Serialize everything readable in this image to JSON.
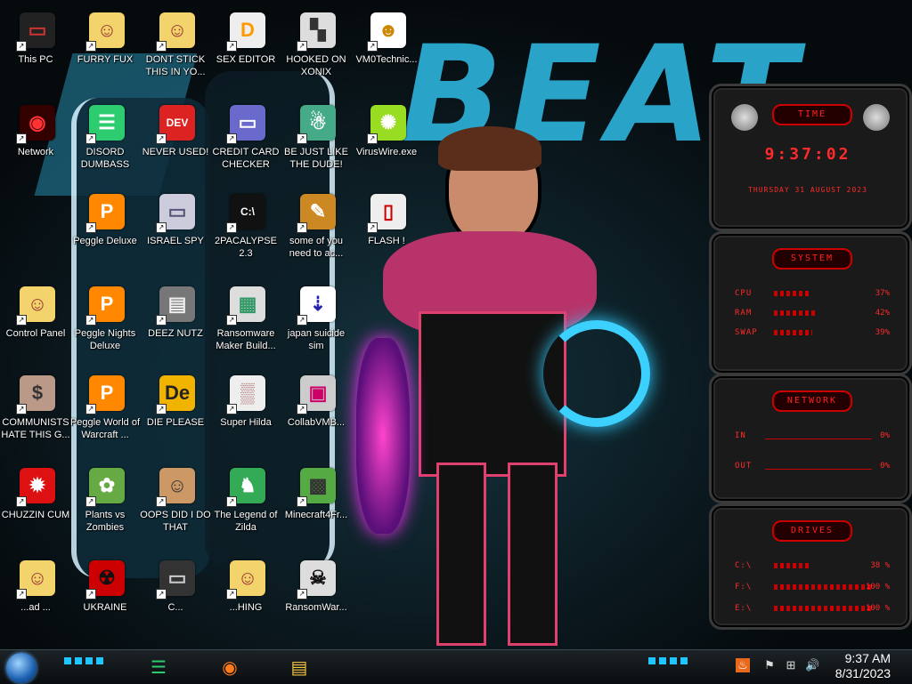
{
  "desktop": {
    "icons": [
      {
        "label": "This PC",
        "glyph": "▭",
        "bg": "#222",
        "fg": "#c33"
      },
      {
        "label": "FURRY FUX",
        "glyph": "☺",
        "bg": "#f3d36b",
        "fg": "#933"
      },
      {
        "label": "DONT STICK THIS IN YO...",
        "glyph": "☺",
        "bg": "#f3d36b",
        "fg": "#933"
      },
      {
        "label": "SEX EDITOR",
        "glyph": "D",
        "bg": "#eee",
        "fg": "#f90"
      },
      {
        "label": "HOOKED ON XONIX",
        "glyph": "▚",
        "bg": "#ddd",
        "fg": "#333"
      },
      {
        "label": "VM0Technic...",
        "glyph": "☻",
        "bg": "#fff",
        "fg": "#c80"
      },
      {
        "label": "Network",
        "glyph": "◉",
        "bg": "#300",
        "fg": "#f33"
      },
      {
        "label": "DISORD DUMBASS",
        "glyph": "☰",
        "bg": "#2ecc71",
        "fg": "#fff"
      },
      {
        "label": "NEVER USED!",
        "glyph": "DEV",
        "bg": "#d22",
        "fg": "#fff"
      },
      {
        "label": "CREDIT CARD CHECKER",
        "glyph": "▭",
        "bg": "#6a6acc",
        "fg": "#fff"
      },
      {
        "label": "BE JUST LIKE THE DUDE!",
        "glyph": "☃",
        "bg": "#4a8",
        "fg": "#fff"
      },
      {
        "label": "VirusWire.exe",
        "glyph": "✺",
        "bg": "#9d2",
        "fg": "#fff"
      },
      {
        "label": "Peggle Deluxe",
        "glyph": "P",
        "bg": "#f80",
        "fg": "#fff"
      },
      {
        "label": "ISRAEL SPY",
        "glyph": "▭",
        "bg": "#ccd",
        "fg": "#557"
      },
      {
        "label": "2PACALYPSE 2.3",
        "glyph": "C:\\",
        "bg": "#111",
        "fg": "#fff"
      },
      {
        "label": "some of you need to ac...",
        "glyph": "✎",
        "bg": "#c82",
        "fg": "#fff"
      },
      {
        "label": "FLASH !",
        "glyph": "▯",
        "bg": "#eee",
        "fg": "#c00"
      },
      {
        "label": "Control Panel",
        "glyph": "☺",
        "bg": "#f3d36b",
        "fg": "#933"
      },
      {
        "label": "Peggle Nights Deluxe",
        "glyph": "P",
        "bg": "#f80",
        "fg": "#fff"
      },
      {
        "label": "DEEZ NUTZ",
        "glyph": "▤",
        "bg": "#777",
        "fg": "#eee"
      },
      {
        "label": "Ransomware Maker Build...",
        "glyph": "▦",
        "bg": "#ddd",
        "fg": "#396"
      },
      {
        "label": "japan suicide sim",
        "glyph": "⇣",
        "bg": "#fff",
        "fg": "#22a"
      },
      {
        "label": "COMMUNISTS HATE THIS G...",
        "glyph": "$",
        "bg": "#b98",
        "fg": "#333"
      },
      {
        "label": "Peggle World of Warcraft ...",
        "glyph": "P",
        "bg": "#f80",
        "fg": "#fff"
      },
      {
        "label": "DIE PLEASE",
        "glyph": "De",
        "bg": "#f0b400",
        "fg": "#222"
      },
      {
        "label": "Super Hilda",
        "glyph": "▒",
        "bg": "#eee",
        "fg": "#a66"
      },
      {
        "label": "CollabVMB...",
        "glyph": "▣",
        "bg": "#ccc",
        "fg": "#c06"
      },
      {
        "label": "CHUZZIN CUM",
        "glyph": "✹",
        "bg": "#d11",
        "fg": "#fff"
      },
      {
        "label": "Plants vs Zombies",
        "glyph": "✿",
        "bg": "#6a4",
        "fg": "#fff"
      },
      {
        "label": "OOPS DID I DO THAT",
        "glyph": "☺",
        "bg": "#c96",
        "fg": "#333"
      },
      {
        "label": "The Legend of Zilda",
        "glyph": "♞",
        "bg": "#3a5",
        "fg": "#fff"
      },
      {
        "label": "Minecraft4Fr...",
        "glyph": "▩",
        "bg": "#5a4",
        "fg": "#333"
      },
      {
        "label": "...ad ...",
        "glyph": "☺",
        "bg": "#f3d36b",
        "fg": "#933"
      },
      {
        "label": "UKRAINE",
        "glyph": "☢",
        "bg": "#c00",
        "fg": "#111"
      },
      {
        "label": "C...",
        "glyph": "▭",
        "bg": "#333",
        "fg": "#ccc"
      },
      {
        "label": "...HING",
        "glyph": "☺",
        "bg": "#f3d36b",
        "fg": "#933"
      },
      {
        "label": "RansomWar...",
        "glyph": "☠",
        "bg": "#ddd",
        "fg": "#111"
      }
    ],
    "wallpaper_text": "BEAT"
  },
  "gadget": {
    "time": {
      "title": "TIME",
      "clock": "9:37:02",
      "date": "THURSDAY 31 AUGUST 2023"
    },
    "system": {
      "title": "SYSTEM",
      "rows": [
        {
          "label": "CPU",
          "value": "37%",
          "level": 0.37
        },
        {
          "label": "RAM",
          "value": "42%",
          "level": 0.42
        },
        {
          "label": "SWAP",
          "value": "39%",
          "level": 0.39
        }
      ]
    },
    "network": {
      "title": "NETWORK",
      "rows": [
        {
          "label": "IN",
          "value": "0%"
        },
        {
          "label": "OUT",
          "value": "0%"
        }
      ]
    },
    "drives": {
      "title": "DRIVES",
      "rows": [
        {
          "label": "C:\\",
          "value": "38 %",
          "level": 0.38
        },
        {
          "label": "F:\\",
          "value": "100 %",
          "level": 1.0
        },
        {
          "label": "E:\\",
          "value": "100 %",
          "level": 1.0
        }
      ]
    }
  },
  "taskbar": {
    "apps": [
      {
        "name": "discord-style-app",
        "glyph": "☰",
        "color": "#2ecc71"
      },
      {
        "name": "firefox",
        "glyph": "◉",
        "color": "#ff7a18"
      },
      {
        "name": "file-explorer",
        "glyph": "▤",
        "color": "#f5c542"
      }
    ],
    "tray": [
      {
        "name": "flag-tray-icon",
        "glyph": "⚑"
      },
      {
        "name": "network-tray-icon",
        "glyph": "⊞"
      },
      {
        "name": "volume-tray-icon",
        "glyph": "🔊"
      }
    ],
    "time": "9:37 AM",
    "date": "8/31/2023"
  }
}
